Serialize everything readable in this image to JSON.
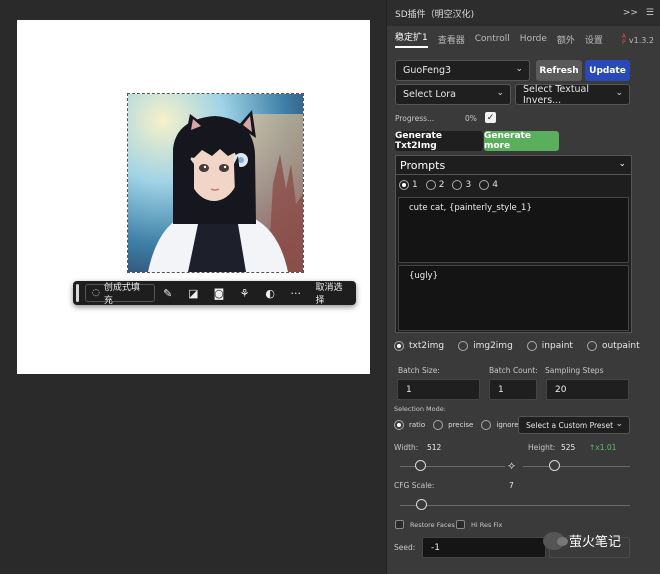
{
  "panel": {
    "title": "SD插件（明空汉化)",
    "title_controls": ">>",
    "menu_icon": "menu-icon",
    "tabs": [
      {
        "label": "稳定扩1",
        "active": true
      },
      {
        "label": "查看器",
        "active": false
      },
      {
        "label": "Controll",
        "active": false
      },
      {
        "label": "Horde",
        "active": false
      },
      {
        "label": "额外",
        "active": false
      },
      {
        "label": "设置",
        "active": false
      }
    ],
    "version": "v1.3.2",
    "version_logo_top": "A",
    "version_logo_bottom": "P"
  },
  "model": {
    "selected": "GuoFeng3"
  },
  "buttons": {
    "refresh": "Refresh",
    "update": "Update",
    "generate_txt2img": "Generate Txt2Img",
    "generate_more": "Generate more",
    "refresh_color": "#5a5a5a",
    "update_color": "#2a49b8",
    "generate_more_color": "#5aaf5c"
  },
  "lora": {
    "placeholder": "Select Lora"
  },
  "textual_inversion": {
    "placeholder": "Select Textual Invers..."
  },
  "progress": {
    "label": "Progress...",
    "value": "0%",
    "checked": true
  },
  "prompts": {
    "header": "Prompts",
    "options": [
      "1",
      "2",
      "3",
      "4"
    ],
    "selected": "1",
    "positive": "cute cat, {painterly_style_1}",
    "negative": "{ugly}"
  },
  "modes": {
    "options": [
      "txt2img",
      "img2img",
      "inpaint",
      "outpaint"
    ],
    "selected": "txt2img"
  },
  "batch": {
    "batch_size_label": "Batch Size:",
    "batch_size": "1",
    "batch_count_label": "Batch Count:",
    "batch_count": "1",
    "sampling_steps_label": "Sampling Steps",
    "sampling_steps": "20"
  },
  "selection_mode": {
    "label": "Selection Mode:",
    "options": [
      "ratio",
      "precise",
      "ignore"
    ],
    "selected": "ratio",
    "preset_placeholder": "Select a Custom Preset"
  },
  "size": {
    "width_label": "Width:",
    "width": "512",
    "height_label": "Height:",
    "height": "525",
    "ratio": "↑x1.01",
    "link_icon": "link-icon"
  },
  "cfg": {
    "label": "CFG Scale:",
    "value": "7"
  },
  "checks": {
    "restore_faces": "Restore Faces",
    "hi_res_fix": "Hi Res Fix"
  },
  "seed": {
    "label": "Seed:",
    "value": "-1"
  },
  "canvas": {
    "toolbar": {
      "generative_fill": "创成式填充",
      "deselect": "取消选择",
      "more": "···",
      "icons": [
        "brush-icon",
        "transform-icon",
        "mask-icon",
        "select-subject-icon",
        "adjust-icon"
      ]
    }
  },
  "watermark": {
    "text": "萤火笔记"
  }
}
